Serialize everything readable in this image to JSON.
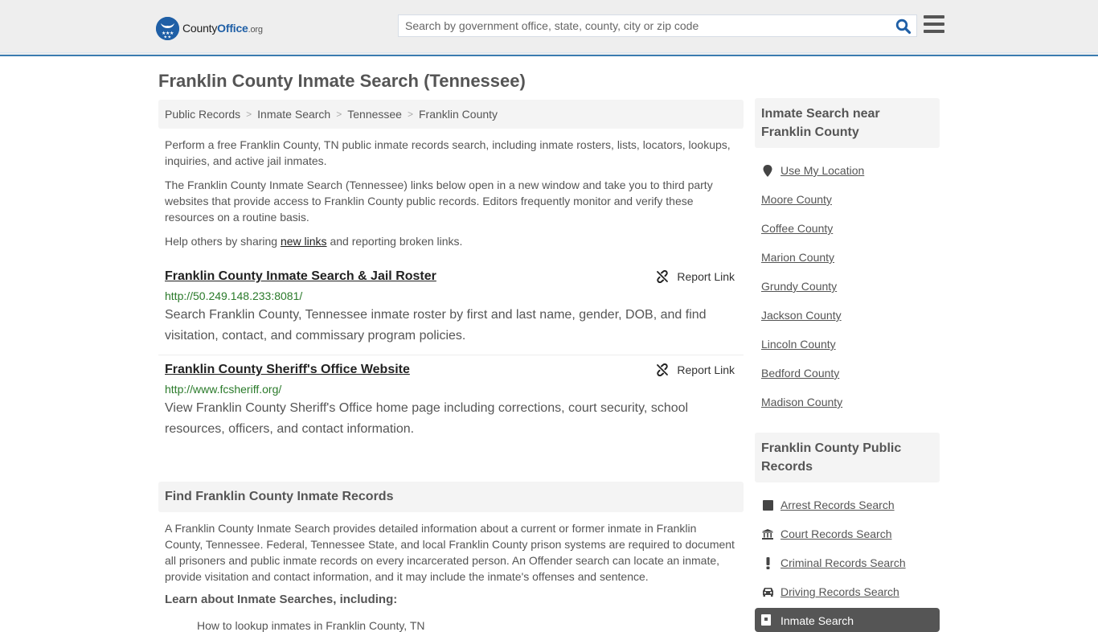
{
  "header": {
    "logo": {
      "county": "County",
      "office": "Office",
      "org": ".org"
    },
    "search_placeholder": "Search by government office, state, county, city or zip code",
    "search_value": "",
    "colors": {
      "brand": "#1f5fa6",
      "accent_border": "#3a7cb0",
      "url_green": "#2a7a2a"
    }
  },
  "page_title": "Franklin County Inmate Search (Tennessee)",
  "breadcrumb": [
    "Public Records",
    "Inmate Search",
    "Tennessee",
    "Franklin County"
  ],
  "intro": {
    "p1": "Perform a free Franklin County, TN public inmate records search, including inmate rosters, lists, locators, lookups, inquiries, and active jail inmates.",
    "p2": "The Franklin County Inmate Search (Tennessee) links below open in a new window and take you to third party websites that provide access to Franklin County public records. Editors frequently monitor and verify these resources on a routine basis.",
    "p3_before": "Help others by sharing ",
    "p3_link": "new links",
    "p3_after": " and reporting broken links."
  },
  "links": [
    {
      "title": "Franklin County Inmate Search & Jail Roster",
      "url": "http://50.249.148.233:8081/",
      "description": "Search Franklin County, Tennessee inmate roster by first and last name, gender, DOB, and find visitation, contact, and commissary program policies.",
      "report_label": "Report Link"
    },
    {
      "title": "Franklin County Sheriff's Office Website",
      "url": "http://www.fcsheriff.org/",
      "description": "View Franklin County Sheriff's Office home page including corrections, court security, school resources, officers, and contact information.",
      "report_label": "Report Link"
    }
  ],
  "find_section": {
    "heading": "Find Franklin County Inmate Records",
    "body": "A Franklin County Inmate Search provides detailed information about a current or former inmate in Franklin County, Tennessee. Federal, Tennessee State, and local Franklin County prison systems are required to document all prisoners and public inmate records on every incarcerated person. An Offender search can locate an inmate, provide visitation and contact information, and it may include the inmate's offenses and sentence.",
    "learn_heading": "Learn about Inmate Searches, including:",
    "learn_items": [
      "How to lookup inmates in Franklin County, TN"
    ]
  },
  "sidebar": {
    "nearby": {
      "heading": "Inmate Search near Franklin County",
      "use_location": "Use My Location",
      "items": [
        "Moore County",
        "Coffee County",
        "Marion County",
        "Grundy County",
        "Jackson County",
        "Lincoln County",
        "Bedford County",
        "Madison County"
      ]
    },
    "public_records": {
      "heading": "Franklin County Public Records",
      "items": [
        {
          "label": "Arrest Records Search",
          "icon": "square-icon"
        },
        {
          "label": "Court Records Search",
          "icon": "courthouse-icon"
        },
        {
          "label": "Criminal Records Search",
          "icon": "exclamation-icon"
        },
        {
          "label": "Driving Records Search",
          "icon": "car-icon"
        }
      ],
      "active_item": {
        "label": "Inmate Search",
        "icon": "id-badge-icon"
      }
    }
  }
}
